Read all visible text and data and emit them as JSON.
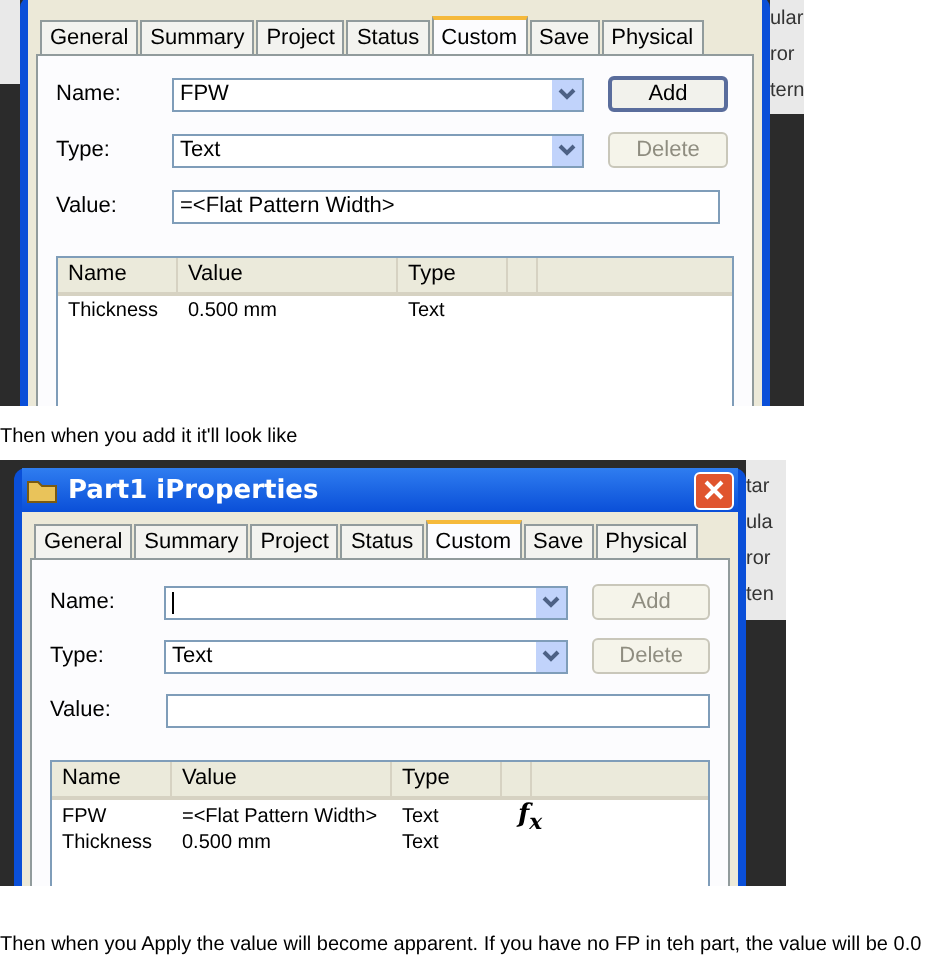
{
  "shots": [
    {
      "side_fragments": [
        "ular",
        "ror",
        "tern"
      ],
      "tabs": [
        {
          "label": "General",
          "selected": false
        },
        {
          "label": "Summary",
          "selected": false
        },
        {
          "label": "Project",
          "selected": false
        },
        {
          "label": "Status",
          "selected": false
        },
        {
          "label": "Custom",
          "selected": true
        },
        {
          "label": "Save",
          "selected": false
        },
        {
          "label": "Physical",
          "selected": false
        }
      ],
      "fields": [
        {
          "label": "Name:",
          "kind": "combo",
          "value": "FPW",
          "focused": false
        },
        {
          "label": "Type:",
          "kind": "combo",
          "value": "Text",
          "focused": false
        },
        {
          "label": "Value:",
          "kind": "text",
          "value": "=<Flat Pattern Width>",
          "focused": false
        }
      ],
      "buttons": [
        {
          "label": "Add",
          "disabled": false,
          "default": true
        },
        {
          "label": "Delete",
          "disabled": true,
          "default": false
        }
      ],
      "columns": [
        "Name",
        "Value",
        "Type"
      ],
      "rows": [
        {
          "cells": [
            "Thickness",
            "0.500 mm",
            "Text"
          ]
        }
      ]
    },
    {
      "title": "Part1 iProperties",
      "side_fragments": [
        "tar",
        "ula",
        "ror",
        "ten"
      ],
      "tabs": [
        {
          "label": "General",
          "selected": false
        },
        {
          "label": "Summary",
          "selected": false
        },
        {
          "label": "Project",
          "selected": false
        },
        {
          "label": "Status",
          "selected": false
        },
        {
          "label": "Custom",
          "selected": true
        },
        {
          "label": "Save",
          "selected": false
        },
        {
          "label": "Physical",
          "selected": false
        }
      ],
      "fields": [
        {
          "label": "Name:",
          "kind": "combo",
          "focused": true
        },
        {
          "label": "Type:",
          "kind": "combo",
          "value": "Text",
          "focused": false
        },
        {
          "label": "Value:",
          "kind": "text",
          "focused": false
        }
      ],
      "buttons": [
        {
          "label": "Add",
          "disabled": true,
          "default": false
        },
        {
          "label": "Delete",
          "disabled": true,
          "default": false
        }
      ],
      "columns": [
        "Name",
        "Value",
        "Type"
      ],
      "rows": [
        {
          "cells": [
            "FPW",
            "=<Flat Pattern Width>",
            "Text"
          ],
          "formula": "*f*$_{x}$"
        },
        {
          "cells": [
            "Thickness",
            "0.500 mm",
            "Text"
          ]
        }
      ]
    }
  ],
  "captions": [
    "Then when you add it it'll look like",
    "Then when you Apply the value will become apparent. If you have no FP in teh part, the value will be 0.0"
  ]
}
